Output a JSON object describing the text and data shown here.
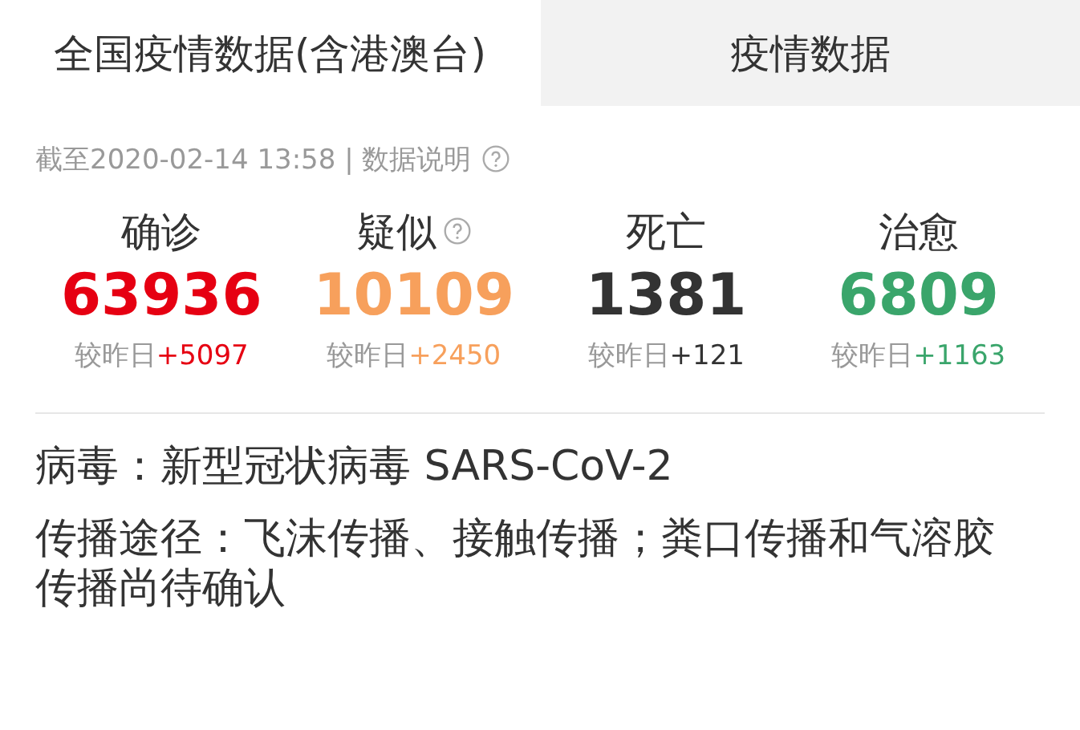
{
  "tabs": [
    {
      "label": "全国疫情数据(含港澳台)",
      "selected": true
    },
    {
      "label": "疫情数据",
      "selected": false
    }
  ],
  "updated": {
    "text": "截至2020-02-14 13:58 | 数据说明",
    "help": true
  },
  "stats": [
    {
      "label": "确诊",
      "help": false,
      "value": "63936",
      "color": "#e60012",
      "delta_label": "较昨日",
      "delta": "+5097"
    },
    {
      "label": "疑似",
      "help": true,
      "value": "10109",
      "color": "#f7a05c",
      "delta_label": "较昨日",
      "delta": "+2450"
    },
    {
      "label": "死亡",
      "help": false,
      "value": "1381",
      "color": "#333333",
      "delta_label": "较昨日",
      "delta": "+121"
    },
    {
      "label": "治愈",
      "help": false,
      "value": "6809",
      "color": "#3aa56b",
      "delta_label": "较昨日",
      "delta": "+1163"
    }
  ],
  "info": [
    {
      "label": "病毒：",
      "text": "新型冠状病毒 SARS-CoV-2"
    },
    {
      "label": "传播途径：",
      "text": "飞沫传播、接触传播；粪口传播和气溶胶传播尚待确认"
    }
  ]
}
